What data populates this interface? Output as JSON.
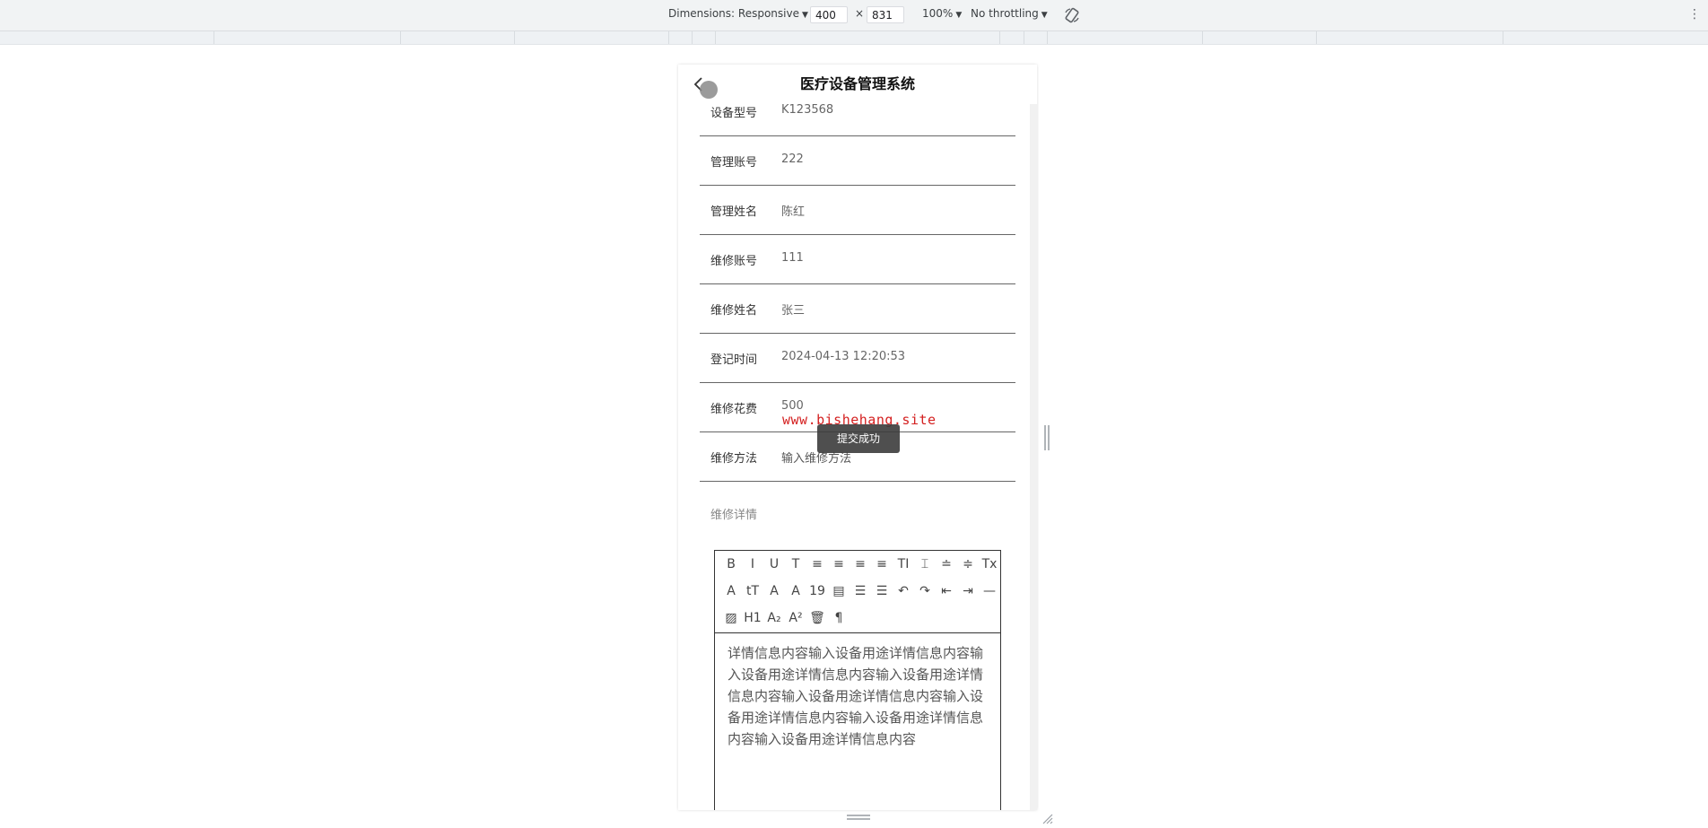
{
  "devtools": {
    "dimensions_label": "Dimensions: Responsive",
    "width": "400",
    "times": "×",
    "height": "831",
    "zoom": "100%",
    "throttling": "No throttling",
    "more": "⋮"
  },
  "app": {
    "title": "医疗设备管理系统"
  },
  "form": {
    "rows": [
      {
        "label": "设备型号",
        "value": "K123568"
      },
      {
        "label": "管理账号",
        "value": "222"
      },
      {
        "label": "管理姓名",
        "value": "陈红"
      },
      {
        "label": "维修账号",
        "value": "111"
      },
      {
        "label": "维修姓名",
        "value": "张三"
      },
      {
        "label": "登记时间",
        "value": "2024-04-13 12:20:53"
      },
      {
        "label": "维修花费",
        "value": "500"
      },
      {
        "label": "维修方法",
        "placeholder": "输入维修方法"
      }
    ],
    "detail_label": "维修详情",
    "detail_content": "详情信息内容输入设备用途详情信息内容输入设备用途详情信息内容输入设备用途详情信息内容输入设备用途详情信息内容输入设备用途详情信息内容输入设备用途详情信息内容输入设备用途详情信息内容"
  },
  "editor_toolbar": [
    {
      "name": "bold-icon",
      "glyph": "B"
    },
    {
      "name": "italic-icon",
      "glyph": "I"
    },
    {
      "name": "underline-icon",
      "glyph": "U"
    },
    {
      "name": "strikethrough-icon",
      "glyph": "T"
    },
    {
      "name": "align-left-icon",
      "glyph": "≡"
    },
    {
      "name": "align-center-icon",
      "glyph": "≡"
    },
    {
      "name": "align-right-icon",
      "glyph": "≡"
    },
    {
      "name": "align-justify-icon",
      "glyph": "≡"
    },
    {
      "name": "font-size-icon",
      "glyph": "TI"
    },
    {
      "name": "line-height-icon",
      "glyph": "⌶"
    },
    {
      "name": "paragraph-spacing-top-icon",
      "glyph": "≐"
    },
    {
      "name": "paragraph-spacing-bottom-icon",
      "glyph": "≑"
    },
    {
      "name": "remove-format-icon",
      "glyph": "Tx"
    },
    {
      "name": "font-family-icon",
      "glyph": "A"
    },
    {
      "name": "font-case-icon",
      "glyph": "tT"
    },
    {
      "name": "font-color-icon",
      "glyph": "A"
    },
    {
      "name": "background-color-icon",
      "glyph": "A"
    },
    {
      "name": "insert-date-icon",
      "glyph": "19"
    },
    {
      "name": "clipboard-icon",
      "glyph": "▤"
    },
    {
      "name": "ordered-list-icon",
      "glyph": "☰"
    },
    {
      "name": "unordered-list-icon",
      "glyph": "☰"
    },
    {
      "name": "undo-icon",
      "glyph": "↶"
    },
    {
      "name": "redo-icon",
      "glyph": "↷"
    },
    {
      "name": "outdent-icon",
      "glyph": "⇤"
    },
    {
      "name": "indent-icon",
      "glyph": "⇥"
    },
    {
      "name": "horizontal-rule-icon",
      "glyph": "—"
    },
    {
      "name": "insert-image-icon",
      "glyph": "▨"
    },
    {
      "name": "heading-icon",
      "glyph": "H1"
    },
    {
      "name": "subscript-icon",
      "glyph": "A₂"
    },
    {
      "name": "superscript-icon",
      "glyph": "A²"
    },
    {
      "name": "clear-content-icon",
      "glyph": "🗑"
    },
    {
      "name": "paragraph-mark-icon",
      "glyph": "¶"
    }
  ],
  "watermark": "www.bishehang.site",
  "toast": "提交成功",
  "colors": {
    "toast_bg": "#3c3c3c",
    "watermark": "#d42020",
    "devtools_bg": "#f1f3f4"
  }
}
